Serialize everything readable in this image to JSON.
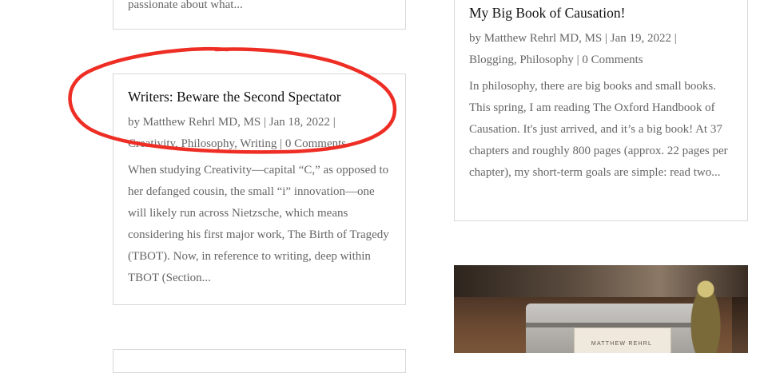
{
  "posts_left": [
    {
      "excerpt_tail": "passionate about what..."
    },
    {
      "title": "Writers: Beware the Second Spectator",
      "author": "by Matthew Rehrl MD, MS",
      "date": "Jan 18, 2022",
      "categories": [
        "Creativity",
        "Philosophy",
        "Writing"
      ],
      "comments": "0 Comments",
      "excerpt": "When studying Creativity—capital “C,” as opposed to her defanged cousin, the small “i” innovation—one will likely run across Nietzsche, which means considering his first major work, The Birth of Tragedy (TBOT). Now, in reference to writing, deep within TBOT (Section..."
    }
  ],
  "posts_right": [
    {
      "title": "My Big Book of Causation!",
      "author": "by Matthew Rehrl MD, MS",
      "date": "Jan 19, 2022",
      "categories": [
        "Blogging",
        "Philosophy"
      ],
      "comments": "0 Comments",
      "excerpt": "In philosophy, there are big books and small books. This spring, I am reading The Oxford Handbook of Causation. It's just arrived, and it’s a big book! At 37 chapters and roughly 800 pages (approx. 22 pages per chapter), my short-term goals are simple: read two..."
    }
  ],
  "photo": {
    "nameplate": "MATTHEW REHRL"
  },
  "separators": {
    "pipe": "|",
    "comma": ","
  },
  "annotation": {
    "color": "#ee2e24"
  }
}
